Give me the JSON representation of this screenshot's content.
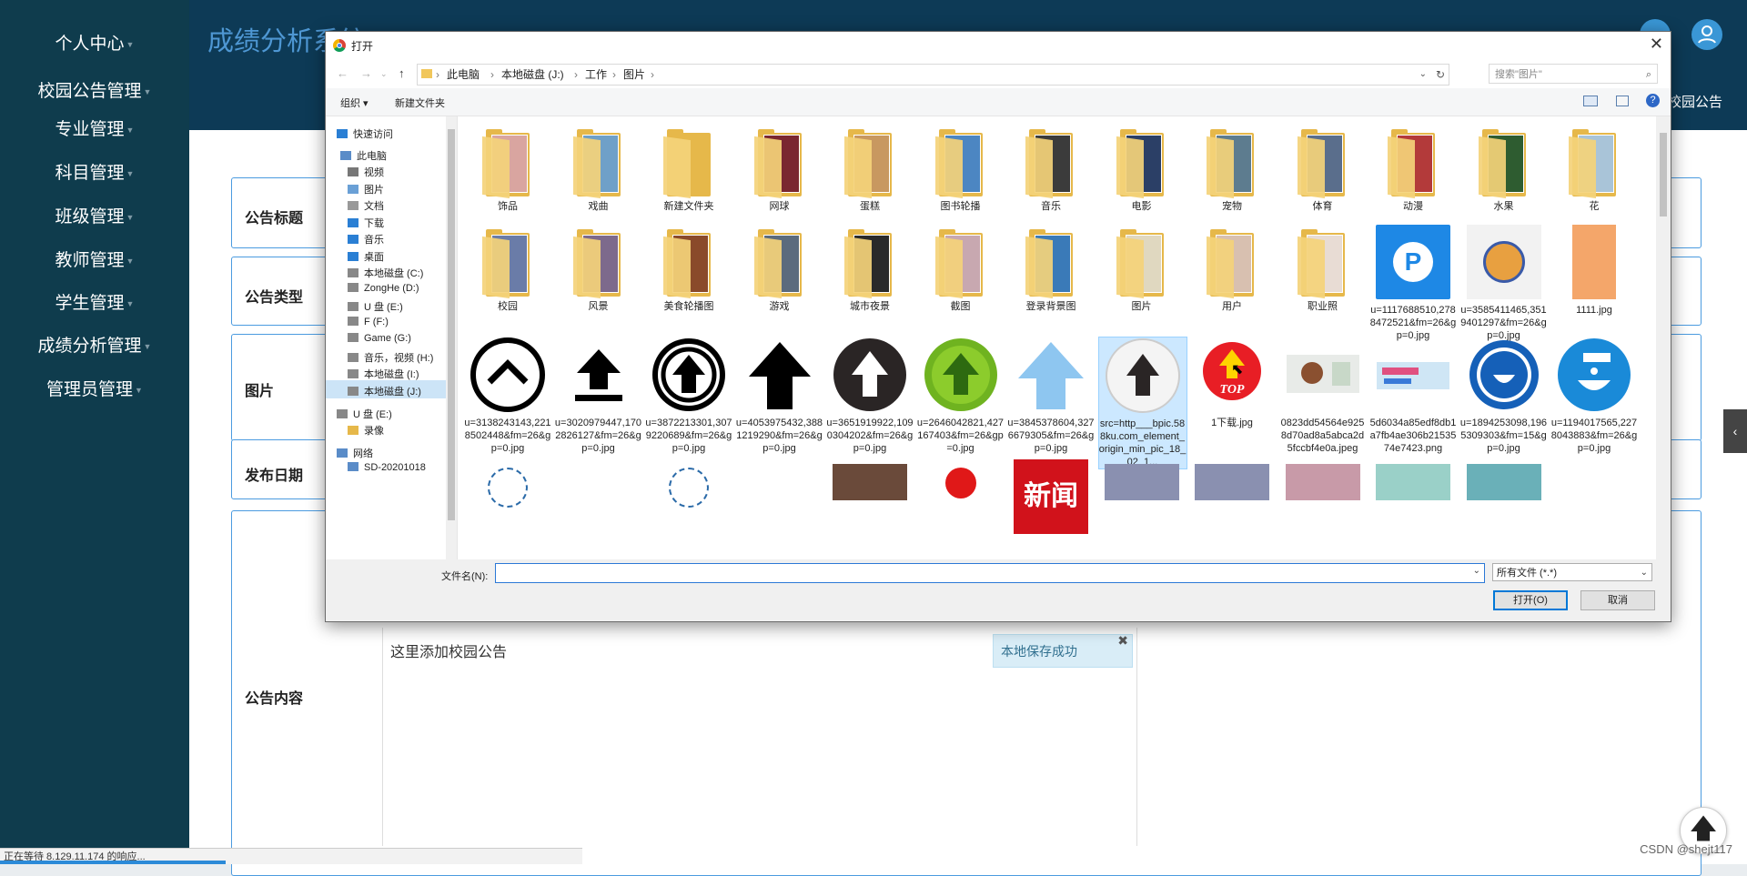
{
  "sidebar": {
    "items": [
      {
        "label": "个人中心"
      },
      {
        "label": "校园公告管理"
      },
      {
        "label": "专业管理"
      },
      {
        "label": "科目管理"
      },
      {
        "label": "班级管理"
      },
      {
        "label": "教师管理"
      },
      {
        "label": "学生管理"
      },
      {
        "label": "成绩分析管理"
      },
      {
        "label": "管理员管理"
      }
    ]
  },
  "header": {
    "title": "成绩分析系统",
    "notice_tab": "校园公告"
  },
  "form": {
    "labels": {
      "title": "公告标题",
      "type": "公告类型",
      "image": "图片",
      "date": "发布日期",
      "content": "公告内容"
    },
    "editor_text": "这里添加校园公告"
  },
  "toast": {
    "text": "本地保存成功",
    "close": "✖"
  },
  "statusbar": {
    "text": "正在等待 8.129.11.174 的响应..."
  },
  "watermark": "CSDN @shejt117",
  "dialog": {
    "title": "打开",
    "close": "✕",
    "path": [
      "此电脑",
      "本地磁盘 (J:)",
      "工作",
      "图片"
    ],
    "search_placeholder": "搜索\"图片\"",
    "organize": "组织 ▾",
    "new_folder": "新建文件夹",
    "nav_items": [
      {
        "label": "快速访问",
        "icon": "star-icon"
      },
      {
        "label": "此电脑",
        "icon": "computer-icon"
      },
      {
        "label": "视频",
        "icon": "video-folder-icon"
      },
      {
        "label": "图片",
        "icon": "pictures-folder-icon"
      },
      {
        "label": "文档",
        "icon": "documents-folder-icon"
      },
      {
        "label": "下载",
        "icon": "download-icon"
      },
      {
        "label": "音乐",
        "icon": "music-icon"
      },
      {
        "label": "桌面",
        "icon": "desktop-icon"
      },
      {
        "label": "本地磁盘 (C:)",
        "icon": "drive-icon"
      },
      {
        "label": "ZongHe (D:)",
        "icon": "drive-icon"
      },
      {
        "label": "U 盘 (E:)",
        "icon": "drive-icon"
      },
      {
        "label": "F (F:)",
        "icon": "drive-icon"
      },
      {
        "label": "Game (G:)",
        "icon": "drive-icon"
      },
      {
        "label": "音乐，视频 (H:)",
        "icon": "drive-icon"
      },
      {
        "label": "本地磁盘 (I:)",
        "icon": "drive-icon"
      },
      {
        "label": "本地磁盘 (J:)",
        "icon": "drive-icon"
      },
      {
        "label": "U 盘 (E:)",
        "icon": "usb-drive-icon"
      },
      {
        "label": "录像",
        "icon": "folder-icon"
      },
      {
        "label": "网络",
        "icon": "network-icon"
      },
      {
        "label": "SD-20201018",
        "icon": "network-computer-icon"
      }
    ],
    "folders_row1": [
      {
        "name": "饰品",
        "color": "#d9a5a0"
      },
      {
        "name": "戏曲",
        "color": "#6fa0c8"
      },
      {
        "name": "新建文件夹",
        "color": ""
      },
      {
        "name": "网球",
        "color": "#7a2730"
      },
      {
        "name": "蛋糕",
        "color": "#c89860"
      },
      {
        "name": "图书轮播",
        "color": "#4c86c2"
      },
      {
        "name": "音乐",
        "color": "#3b3b3b"
      },
      {
        "name": "电影",
        "color": "#2b3f66"
      },
      {
        "name": "宠物",
        "color": "#5d7c8f"
      },
      {
        "name": "体育",
        "color": "#5a6e8c"
      },
      {
        "name": "动漫",
        "color": "#b33a3a"
      },
      {
        "name": "水果",
        "color": "#2e5c30"
      },
      {
        "name": "花",
        "color": "#a9c4d8"
      }
    ],
    "row2": [
      {
        "name": "校园",
        "kind": "folder",
        "color": "#6a7ca8"
      },
      {
        "name": "风景",
        "kind": "folder",
        "color": "#7d6a8c"
      },
      {
        "name": "美食轮播图",
        "kind": "folder",
        "color": "#8a4a2a"
      },
      {
        "name": "游戏",
        "kind": "folder",
        "color": "#5b6b7d"
      },
      {
        "name": "城市夜景",
        "kind": "folder",
        "color": "#2a2a2a"
      },
      {
        "name": "截图",
        "kind": "folder",
        "color": "#c8a8b0"
      },
      {
        "name": "登录背景图",
        "kind": "folder",
        "color": "#3a7ab8"
      },
      {
        "name": "图片",
        "kind": "folder",
        "color": "#e0d8c0"
      },
      {
        "name": "用户",
        "kind": "folder",
        "color": "#d8c0b0"
      },
      {
        "name": "职业照",
        "kind": "folder",
        "color": "#e8dcd4"
      },
      {
        "name": "u=1117688510,2788472521&fm=26&gp=0.jpg",
        "kind": "thumb",
        "color": "#1e88e5"
      },
      {
        "name": "u=3585411465,3519401297&fm=26&gp=0.jpg",
        "kind": "thumb",
        "color": "#f2f2f2"
      },
      {
        "name": "1111.jpg",
        "kind": "thumb",
        "color": "#f4a66a"
      }
    ],
    "row3": [
      {
        "name": "u=3138243143,2218502448&fm=26&gp=0.jpg",
        "icon": "circle-chevron-up-icon"
      },
      {
        "name": "u=3020979447,1702826127&fm=26&gp=0.jpg",
        "icon": "upload-arrow-icon"
      },
      {
        "name": "u=3872213301,3079220689&fm=26&gp=0.jpg",
        "icon": "circle-arrow-up-icon"
      },
      {
        "name": "u=4053975432,3881219290&fm=26&gp=0.jpg",
        "icon": "bold-arrow-up-icon"
      },
      {
        "name": "u=3651919922,1090304202&fm=26&gp=0.jpg",
        "icon": "dark-circle-arrow-icon"
      },
      {
        "name": "u=2646042821,427167403&fm=26&gp=0.jpg",
        "icon": "green-circle-arrow-icon"
      },
      {
        "name": "u=3845378604,3276679305&fm=26&gp=0.jpg",
        "icon": "blue-arrow-up-icon"
      },
      {
        "name": "src=http___bpic.588ku.com_element_origin_min_pic_18_02_1...",
        "icon": "grey-circle-arrow-icon"
      },
      {
        "name": "1下载.jpg",
        "icon": "top-badge-icon"
      },
      {
        "name": "0823dd54564e9258d70ad8a5abca2d5fccbf4e0a.jpeg",
        "icon": "illustration-thumb-icon"
      },
      {
        "name": "5d6034a85edf8db1a7fb4ae306b2153574e7423.png",
        "icon": "banner-thumb-icon"
      },
      {
        "name": "u=1894253098,1965309303&fm=15&gp=0.jpg",
        "icon": "mask-face-icon"
      },
      {
        "name": "u=1194017565,2278043883&fm=26&gp=0.jpg",
        "icon": "handwash-icon"
      }
    ],
    "row4_partial": [
      "新闻"
    ],
    "filename_label": "文件名(N):",
    "filetype": "所有文件 (*.*)",
    "open_btn": "打开(O)",
    "cancel_btn": "取消"
  },
  "colors": {
    "sidebar": "#0f3c4d",
    "header": "#0d3a56",
    "accent": "#4b9be0"
  }
}
